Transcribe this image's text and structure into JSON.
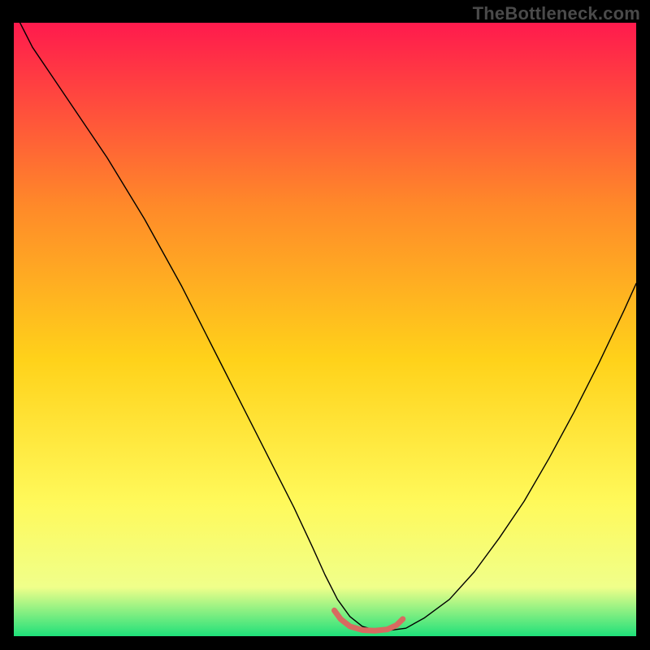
{
  "watermark": "TheBottleneck.com",
  "chart_data": {
    "type": "line",
    "title": "",
    "xlabel": "",
    "ylabel": "",
    "xlim": [
      0,
      100
    ],
    "ylim": [
      0,
      100
    ],
    "grid": false,
    "legend": false,
    "background_gradient": {
      "top_color": "#ff1a4d",
      "upper_mid_color": "#ff8a29",
      "mid_color": "#ffd21a",
      "lower_mid_color": "#fff95a",
      "band_near_bottom_color": "#f0ff8a",
      "bottom_color": "#1fe07a"
    },
    "series": [
      {
        "name": "bottleneck-curve",
        "color": "#000000",
        "stroke_width": 1.4,
        "x": [
          1,
          3,
          6,
          9,
          12,
          15,
          18,
          21,
          24,
          27,
          30,
          33,
          36,
          39,
          42,
          45,
          48,
          50,
          52,
          54,
          56,
          58,
          60,
          63,
          66,
          70,
          74,
          78,
          82,
          86,
          90,
          94,
          98,
          100
        ],
        "y": [
          100,
          96,
          91.5,
          87,
          82.5,
          78,
          73,
          68,
          62.5,
          57,
          51,
          45,
          39,
          33,
          27,
          21,
          14.5,
          10,
          6,
          3.2,
          1.6,
          1.0,
          0.9,
          1.3,
          3.0,
          6.0,
          10.5,
          16,
          22,
          29,
          36.5,
          44.5,
          53,
          57.5
        ]
      },
      {
        "name": "optimal-zone-highlight",
        "color": "#d86a60",
        "stroke_width": 7,
        "x": [
          51.5,
          52.5,
          54,
          56,
          58,
          60,
          61.5,
          62.5
        ],
        "y": [
          4.2,
          2.8,
          1.6,
          1.0,
          0.9,
          1.1,
          1.8,
          2.8
        ]
      }
    ]
  }
}
